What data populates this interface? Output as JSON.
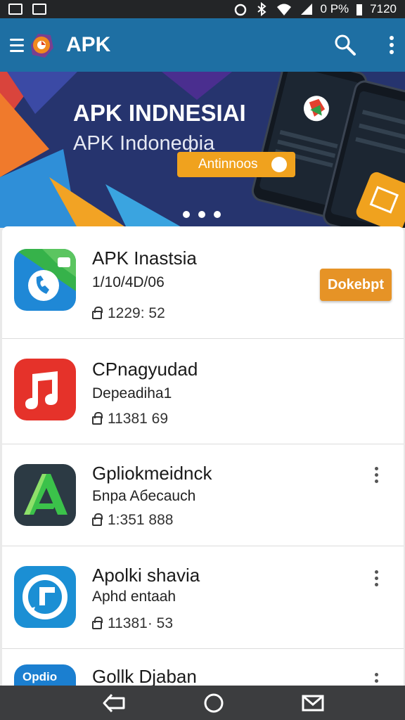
{
  "status": {
    "battery_text": "0 P%",
    "time": "7120"
  },
  "app": {
    "title": "APK"
  },
  "banner": {
    "title": "APK INDNESIAI",
    "subtitle": "APK Indoneфia",
    "button_label": "Antinnoos"
  },
  "apps": [
    {
      "name": "APK Inastsia",
      "subtitle": "1/10/4D/06",
      "meta": "1229: 52",
      "action_label": "Dokebpt"
    },
    {
      "name": "CPnagyudad",
      "subtitle": "Depeadiha1",
      "meta": "11381 69"
    },
    {
      "name": "Gpliokmeidnck",
      "subtitle": "Бnpa Aбeсauch",
      "meta": "1:351 888"
    },
    {
      "name": "Apolki shavia",
      "subtitle": "Aphd entaah",
      "meta": "11381· 53"
    },
    {
      "name": "Gollk Djaban",
      "icon_text": "Opdio"
    }
  ],
  "colors": {
    "appbar": "#1e6fa3",
    "accent": "#e69326",
    "navbar": "#3c3d3f"
  }
}
